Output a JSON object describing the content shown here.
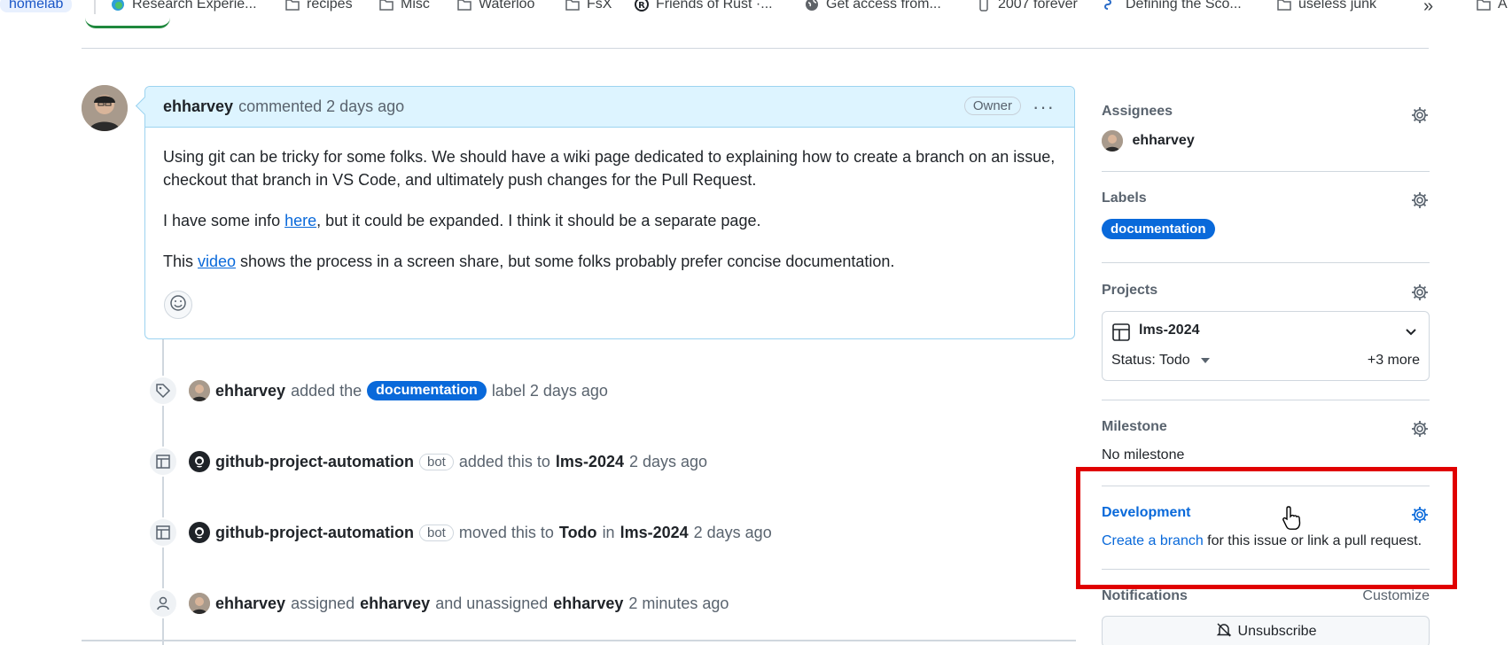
{
  "bookmarks": {
    "items": [
      {
        "label": "homelab",
        "icon": "folder-icon"
      },
      {
        "label": "Research Experie...",
        "icon": "edge-icon"
      },
      {
        "label": "recipes",
        "icon": "folder-icon"
      },
      {
        "label": "Misc",
        "icon": "folder-icon"
      },
      {
        "label": "Waterloo",
        "icon": "folder-icon"
      },
      {
        "label": "FsX",
        "icon": "folder-icon"
      },
      {
        "label": "Friends of Rust ·...",
        "icon": "rust-icon"
      },
      {
        "label": "Get access from...",
        "icon": "globe-icon"
      },
      {
        "label": "2007 forever",
        "icon": "phone-icon"
      },
      {
        "label": "Defining the Sco...",
        "icon": "link-icon"
      },
      {
        "label": "useless junk",
        "icon": "folder-icon"
      },
      {
        "label": "»",
        "icon": ""
      },
      {
        "label": "A",
        "icon": "folder-icon"
      }
    ]
  },
  "comment": {
    "author": "ehharvey",
    "meta": "commented 2 days ago",
    "badge": "Owner",
    "menu_glyph": "···",
    "p1": "Using git can be tricky for some folks. We should have a wiki page dedicated to explaining how to create a branch on an issue, checkout that branch in VS Code, and ultimately push changes for the Pull Request.",
    "p2_before": "I have some info ",
    "p2_link": "here",
    "p2_after": ", but it could be expanded. I think it should be a separate page.",
    "p3_before": "This ",
    "p3_link": "video",
    "p3_after": " shows the process in a screen share, but some folks probably prefer concise documentation."
  },
  "timeline": {
    "e1": {
      "actor": "ehharvey",
      "t1": "added the",
      "label": "documentation",
      "t2": "label 2 days ago"
    },
    "e2": {
      "actor": "github-project-automation",
      "bot": "bot",
      "t1": "added this to",
      "target": "lms-2024",
      "t2": "2 days ago"
    },
    "e3": {
      "actor": "github-project-automation",
      "bot": "bot",
      "t1": "moved this to",
      "status": "Todo",
      "t2": "in",
      "target": "lms-2024",
      "t3": "2 days ago"
    },
    "e4": {
      "actor": "ehharvey",
      "t1": "assigned",
      "assignee": "ehharvey",
      "t2": "and unassigned",
      "unassignee": "ehharvey",
      "t3": "2 minutes ago"
    }
  },
  "sidebar": {
    "assignees": {
      "title": "Assignees",
      "user": "ehharvey"
    },
    "labels": {
      "title": "Labels",
      "label": "documentation"
    },
    "projects": {
      "title": "Projects",
      "name": "lms-2024",
      "status": "Status: Todo",
      "more": "+3 more"
    },
    "milestone": {
      "title": "Milestone",
      "value": "No milestone"
    },
    "development": {
      "title": "Development",
      "link": "Create a branch",
      "text": " for this issue or link a pull request."
    },
    "notifications": {
      "title": "Notifications",
      "customize": "Customize",
      "button": "Unsubscribe"
    }
  },
  "colors": {
    "accent": "#0969da",
    "highlight": "#e00000",
    "header_bg": "#ddf4ff"
  }
}
